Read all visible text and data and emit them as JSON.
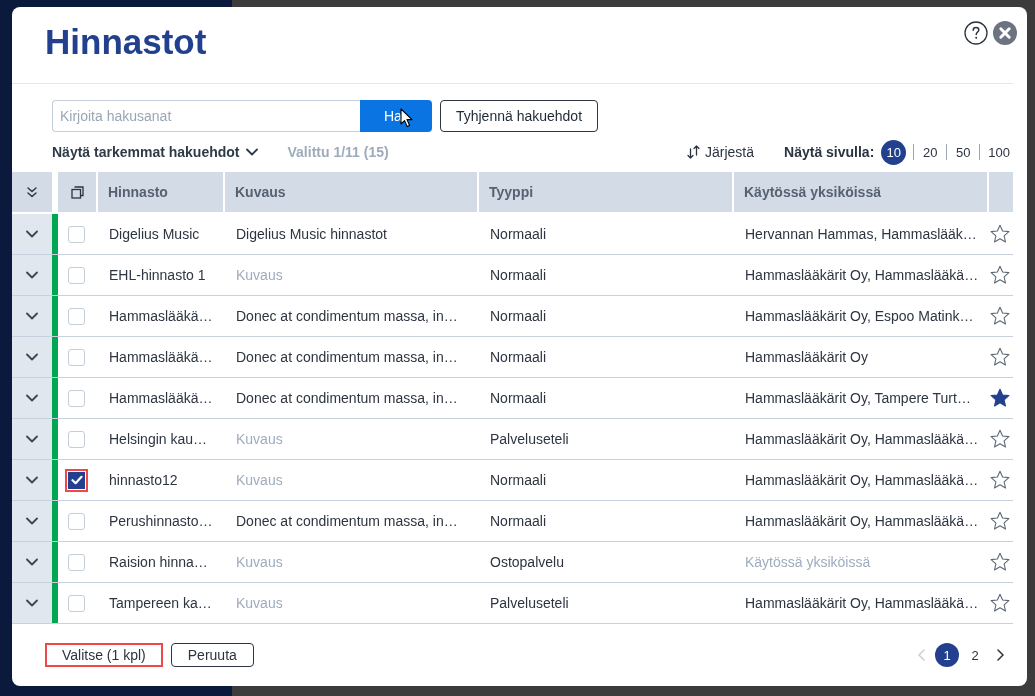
{
  "dialog": {
    "title": "Hinnastot",
    "search": {
      "placeholder": "Kirjoita hakusanat",
      "button": "Ha",
      "clear_button": "Tyhjennä hakuehdot"
    },
    "advanced_toggle": "Näytä tarkemmat hakuehdot",
    "selection_count": "Valittu 1/11 (15)",
    "sort_button": "Järjestä",
    "page_size": {
      "label": "Näytä sivulla:",
      "options": [
        {
          "label": "10",
          "selected": true
        },
        {
          "label": "20",
          "selected": false
        },
        {
          "label": "50",
          "selected": false
        },
        {
          "label": "100",
          "selected": false
        }
      ]
    },
    "table": {
      "columns": [
        "Hinnasto",
        "Kuvaus",
        "Tyyppi",
        "Käytössä yksiköissä"
      ],
      "rows": [
        {
          "name": "Digelius Music",
          "description": {
            "text": "Digelius Music hinnastot",
            "empty": false
          },
          "type": "Normaali",
          "units": {
            "text": "Hervannan Hammas, Hammaslääk…",
            "empty": false
          },
          "active": true,
          "checked": false,
          "highlighted": false,
          "favorite": false
        },
        {
          "name": "EHL-hinnasto 1",
          "description": {
            "text": "Kuvaus",
            "empty": true
          },
          "type": "Normaali",
          "units": {
            "text": "Hammaslääkärit Oy, Hammaslääkä…",
            "empty": false
          },
          "active": true,
          "checked": false,
          "highlighted": false,
          "favorite": false
        },
        {
          "name": "Hammaslääkä…",
          "description": {
            "text": "Donec at condimentum massa, in…",
            "empty": false
          },
          "type": "Normaali",
          "units": {
            "text": "Hammaslääkärit Oy, Espoo Matink…",
            "empty": false
          },
          "active": true,
          "checked": false,
          "highlighted": false,
          "favorite": false
        },
        {
          "name": "Hammaslääkä…",
          "description": {
            "text": "Donec at condimentum massa, in…",
            "empty": false
          },
          "type": "Normaali",
          "units": {
            "text": "Hammaslääkärit Oy",
            "empty": false
          },
          "active": true,
          "checked": false,
          "highlighted": false,
          "favorite": false
        },
        {
          "name": "Hammaslääkä…",
          "description": {
            "text": "Donec at condimentum massa, in…",
            "empty": false
          },
          "type": "Normaali",
          "units": {
            "text": "Hammaslääkärit Oy, Tampere Turt…",
            "empty": false
          },
          "active": true,
          "checked": false,
          "highlighted": false,
          "favorite": true
        },
        {
          "name": "Helsingin kau…",
          "description": {
            "text": "Kuvaus",
            "empty": true
          },
          "type": "Palveluseteli",
          "units": {
            "text": "Hammaslääkärit Oy, Hammaslääkä…",
            "empty": false
          },
          "active": true,
          "checked": false,
          "highlighted": false,
          "favorite": false
        },
        {
          "name": "hinnasto12",
          "description": {
            "text": "Kuvaus",
            "empty": true
          },
          "type": "Normaali",
          "units": {
            "text": "Hammaslääkärit Oy, Hammaslääkä…",
            "empty": false
          },
          "active": true,
          "checked": true,
          "highlighted": true,
          "favorite": false
        },
        {
          "name": "Perushinnasto…",
          "description": {
            "text": "Donec at condimentum massa, in…",
            "empty": false
          },
          "type": "Normaali",
          "units": {
            "text": "Hammaslääkärit Oy, Hammaslääkä…",
            "empty": false
          },
          "active": true,
          "checked": false,
          "highlighted": false,
          "favorite": false
        },
        {
          "name": "Raision hinna…",
          "description": {
            "text": "Kuvaus",
            "empty": true
          },
          "type": "Ostopalvelu",
          "units": {
            "text": "Käytössä yksiköissä",
            "empty": true
          },
          "active": true,
          "checked": false,
          "highlighted": false,
          "favorite": false
        },
        {
          "name": "Tampereen ka…",
          "description": {
            "text": "Kuvaus",
            "empty": true
          },
          "type": "Palveluseteli",
          "units": {
            "text": "Hammaslääkärit Oy, Hammaslääkä…",
            "empty": false
          },
          "active": true,
          "checked": false,
          "highlighted": false,
          "favorite": false
        }
      ]
    },
    "footer": {
      "select_button": {
        "label": "Valitse (1 kpl)",
        "highlighted": true
      },
      "cancel_button": "Peruuta"
    },
    "pagination": {
      "previous_disabled": true,
      "next_disabled": false,
      "pages": [
        {
          "label": "1",
          "selected": true
        },
        {
          "label": "2",
          "selected": false
        }
      ]
    }
  }
}
